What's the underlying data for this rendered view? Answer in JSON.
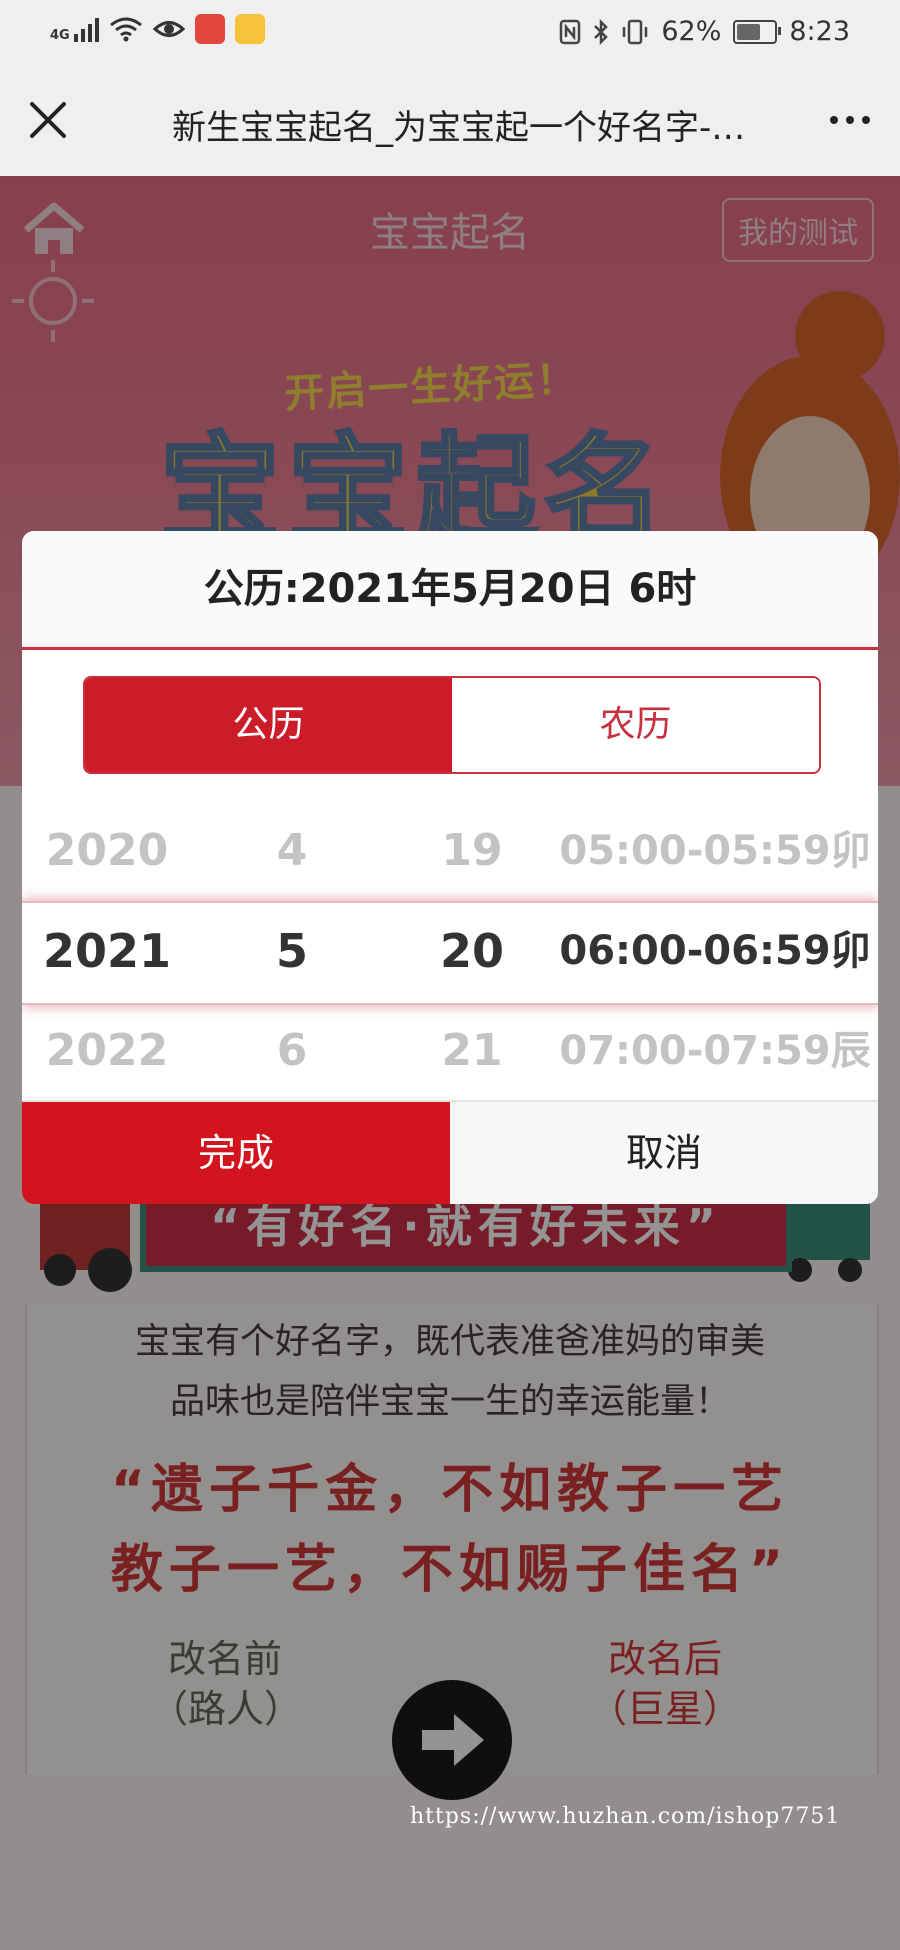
{
  "status_bar": {
    "network": "4G",
    "battery": "62%",
    "time": "8:23",
    "battery_level": 0.62
  },
  "title_bar": {
    "title": "新生宝宝起名_为宝宝起一个好名字-…"
  },
  "page": {
    "header_title": "宝宝起名",
    "my_test_label": "我的测试",
    "banner_subtitle": "开启一生好运！",
    "banner_title": "宝宝起名",
    "slogan": "“有好名·就有好未来”",
    "description_line1": "宝宝有个好名字，既代表准爸准妈的审美",
    "description_line2": "品味也是陪伴宝宝一生的幸运能量！",
    "quote_line1": "“遗子千金，不如教子一艺",
    "quote_line2": "教子一艺，不如赐子佳名”",
    "before_line1": "改名前",
    "before_line2": "（路人）",
    "after_line1": "改名后",
    "after_line2": "（巨星）",
    "watermark": "https://www.huzhan.com/ishop7751"
  },
  "date_picker": {
    "header": "公历:2021年5月20日 6时",
    "calendar_tabs": {
      "solar": "公历",
      "lunar": "农历",
      "selected": "公历"
    },
    "rows": [
      {
        "year": "2020",
        "month": "4",
        "day": "19",
        "hour": "05:00-05:59卯"
      },
      {
        "year": "2021",
        "month": "5",
        "day": "20",
        "hour": "06:00-06:59卯"
      },
      {
        "year": "2022",
        "month": "6",
        "day": "21",
        "hour": "07:00-07:59辰"
      }
    ],
    "done_label": "完成",
    "cancel_label": "取消"
  },
  "colors": {
    "accent_red": "#d2141f",
    "hero_pink": "#e96d86"
  }
}
